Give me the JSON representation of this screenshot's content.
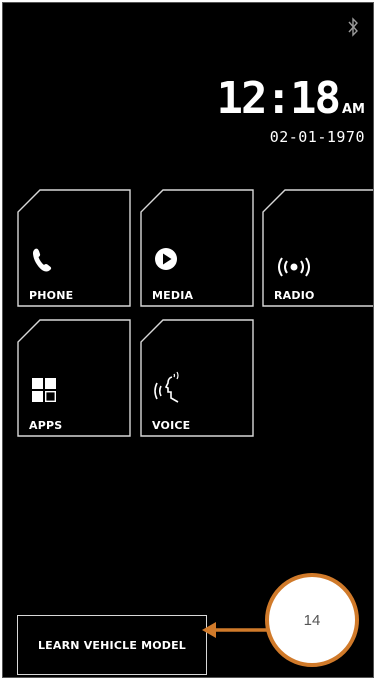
{
  "status_bar": {
    "bluetooth_icon": "bluetooth-icon"
  },
  "clock": {
    "time": "12:18",
    "ampm": "AM",
    "date": "02-01-1970"
  },
  "tiles": [
    {
      "label": "PHONE",
      "icon": "phone-icon"
    },
    {
      "label": "MEDIA",
      "icon": "play-icon"
    },
    {
      "label": "RADIO",
      "icon": "radio-broadcast-icon"
    },
    {
      "label": "APPS",
      "icon": "apps-grid-icon"
    },
    {
      "label": "VOICE",
      "icon": "voice-head-icon"
    }
  ],
  "learn_button": {
    "label": "LEARN VEHICLE MODEL"
  },
  "annotation": {
    "number": "14"
  },
  "colors": {
    "background": "#000000",
    "tile_border": "#d8d8d8",
    "text": "#ffffff",
    "callout_accent": "#d07a2a"
  }
}
